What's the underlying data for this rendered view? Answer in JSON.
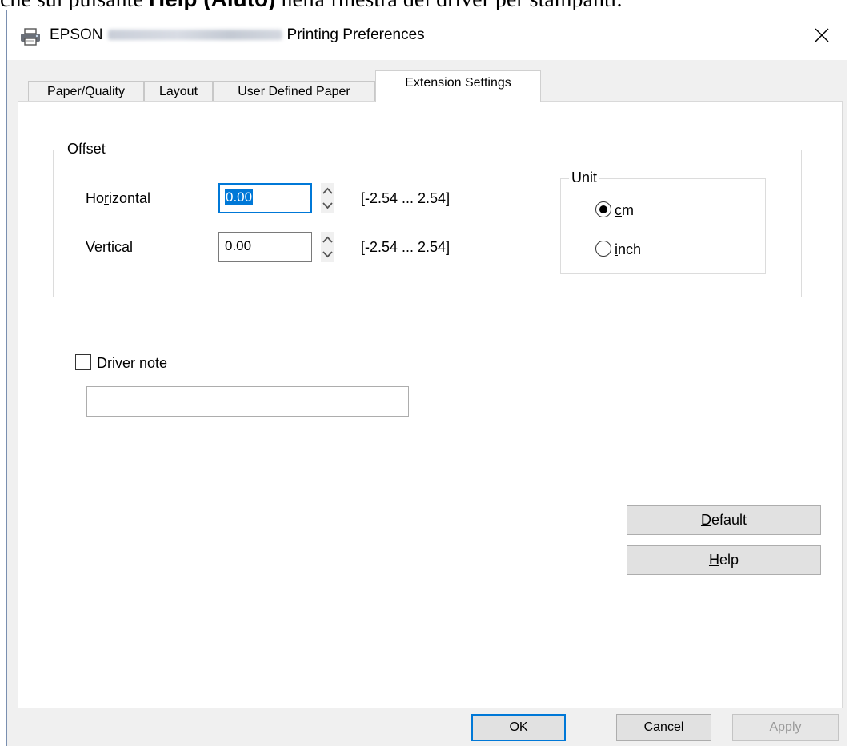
{
  "doc_caption": {
    "prefix": "che sul pulsante ",
    "bold": "Help (Aiuto)",
    "suffix": " nella finestra del driver per stampanti."
  },
  "window": {
    "title_prefix": "EPSON",
    "title_suffix": "Printing Preferences",
    "close_icon": "close-icon"
  },
  "tabs": [
    {
      "label": "Paper/Quality"
    },
    {
      "label": "Layout"
    },
    {
      "label": "User Defined Paper"
    },
    {
      "label": "Extension Settings",
      "active": true
    }
  ],
  "offset": {
    "group_label": "Offset",
    "horizontal": {
      "label_pre": "Ho",
      "label_mnemonic": "r",
      "label_post": "izontal",
      "value": "0.00",
      "range": "[-2.54 ... 2.54]"
    },
    "vertical": {
      "label_pre": "",
      "label_mnemonic": "V",
      "label_post": "ertical",
      "value": "0.00",
      "range": "[-2.54 ... 2.54]"
    }
  },
  "unit": {
    "group_label": "Unit",
    "options": [
      {
        "mnemonic": "c",
        "rest": "m",
        "selected": true
      },
      {
        "mnemonic": "i",
        "rest": "nch",
        "selected": false
      }
    ]
  },
  "driver_note": {
    "label_pre": "Driver ",
    "label_mnemonic": "n",
    "label_post": "ote",
    "checked": false,
    "value": ""
  },
  "side_buttons": {
    "default": {
      "mnemonic": "D",
      "rest": "efault"
    },
    "help": {
      "mnemonic": "H",
      "rest": "elp"
    }
  },
  "footer": {
    "ok": "OK",
    "cancel": "Cancel",
    "apply": "Apply"
  },
  "colors": {
    "accent": "#0078d7",
    "dialog_bg": "#f0f0f0",
    "panel_bg": "#ffffff"
  }
}
